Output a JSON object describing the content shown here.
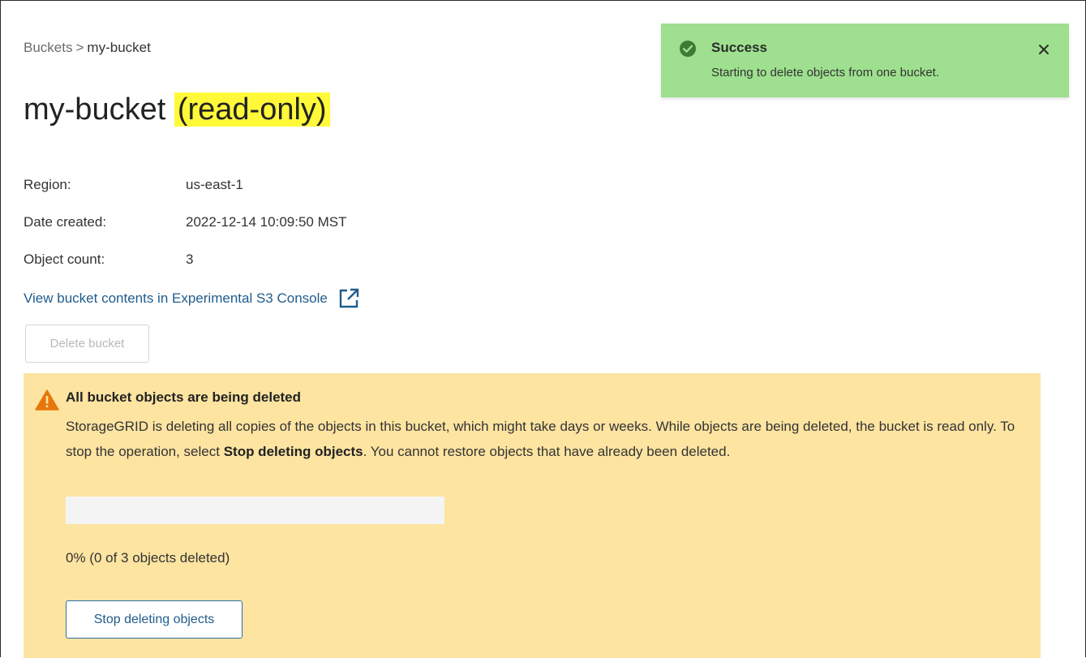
{
  "breadcrumb": {
    "parent": "Buckets",
    "separator": ">",
    "current": "my-bucket"
  },
  "page_title": {
    "name": "my-bucket",
    "status": "(read-only)"
  },
  "details": [
    {
      "label": "Region:",
      "value": "us-east-1"
    },
    {
      "label": "Date created:",
      "value": "2022-12-14 10:09:50 MST"
    },
    {
      "label": "Object count:",
      "value": "3"
    }
  ],
  "s3_console_link": {
    "label": "View bucket contents in Experimental S3 Console",
    "icon": "external-link-icon"
  },
  "delete_bucket_button": {
    "label": "Delete bucket",
    "disabled": true
  },
  "warning": {
    "icon": "warning-triangle-icon",
    "title": "All bucket objects are being deleted",
    "body_before": "StorageGRID is deleting all copies of the objects in this bucket, which might take days or weeks. While objects are being deleted, the bucket is read only. To stop the operation, select ",
    "body_bold": "Stop deleting objects",
    "body_after": ". You cannot restore objects that have already been deleted.",
    "progress_fraction": 0,
    "progress_text": "0% (0 of 3 objects deleted)",
    "stop_button_label": "Stop deleting objects"
  },
  "toast": {
    "icon": "check-circle-icon",
    "title": "Success",
    "message": "Starting to delete objects from one bucket.",
    "close_icon": "close-icon"
  },
  "colors": {
    "toast_bg": "#9ee08f",
    "warning_bg": "#fde4a1",
    "readonly_highlight": "#fff93a",
    "link": "#1f5c8c",
    "warning_icon": "#e8760c"
  }
}
